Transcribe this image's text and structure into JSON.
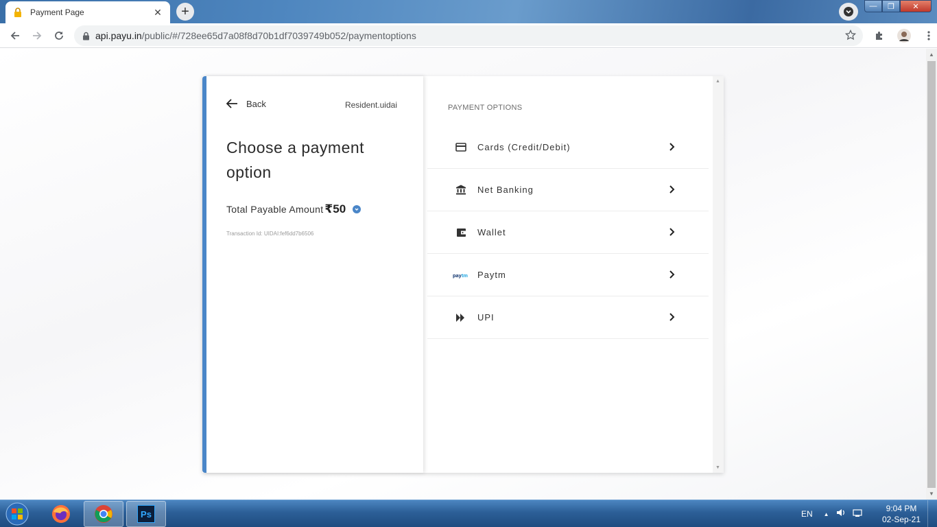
{
  "browser": {
    "tab_title": "Payment Page",
    "url_host": "api.payu.in",
    "url_path": "/public/#/728ee65d7a08f8d70b1df7039749b052/paymentoptions",
    "icons": [
      "lock-icon",
      "close-icon",
      "new-tab-icon",
      "back-arrow-icon",
      "forward-arrow-icon",
      "reload-icon",
      "bookmark-star-icon",
      "extensions-icon",
      "profile-avatar",
      "menu-kebab-icon"
    ]
  },
  "left_panel": {
    "back_label": "Back",
    "merchant": "Resident.uidai",
    "heading": "Choose a payment option",
    "amount_label": "Total Payable Amount",
    "amount_value": "₹50",
    "transaction": "Transaction Id: UIDAI:fef6dd7b6506",
    "accent_color": "#4a86c8"
  },
  "right_panel": {
    "title": "PAYMENT OPTIONS",
    "options": [
      {
        "label": "Cards (Credit/Debit)",
        "icon": "credit-card-icon"
      },
      {
        "label": "Net Banking",
        "icon": "bank-icon"
      },
      {
        "label": "Wallet",
        "icon": "wallet-icon"
      },
      {
        "label": "Paytm",
        "icon": "paytm-logo"
      },
      {
        "label": "UPI",
        "icon": "upi-icon"
      }
    ]
  },
  "taskbar": {
    "language": "EN",
    "time": "9:04 PM",
    "date": "02-Sep-21",
    "apps": [
      "firefox-icon",
      "chrome-icon",
      "photoshop-icon"
    ],
    "photoshop_label": "Ps"
  }
}
